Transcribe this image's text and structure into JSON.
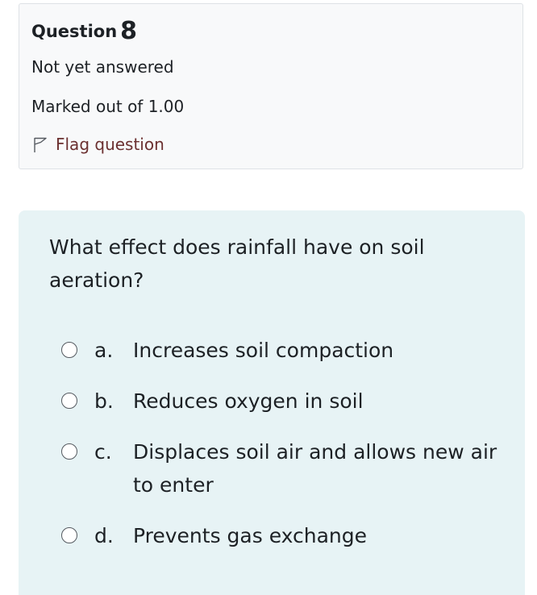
{
  "question": {
    "label": "Question",
    "number": "8",
    "state": "Not yet answered",
    "grade": "Marked out of 1.00",
    "flag_label": "Flag question",
    "flag_icon": "flag-outline-icon"
  },
  "content": {
    "question_text": "What effect does rainfall have on soil aeration?",
    "answers": [
      {
        "number": "a.",
        "label": "Increases soil compaction",
        "selected": false
      },
      {
        "number": "b.",
        "label": "Reduces oxygen in soil",
        "selected": false
      },
      {
        "number": "c.",
        "label": "Displaces soil air and allows new air to enter",
        "selected": false
      },
      {
        "number": "d.",
        "label": "Prevents gas exchange",
        "selected": false
      }
    ]
  },
  "colors": {
    "info_background": "#f8f9fa",
    "content_background": "#e7f3f5",
    "flag_text": "#6b3030",
    "text": "#1d2125"
  }
}
